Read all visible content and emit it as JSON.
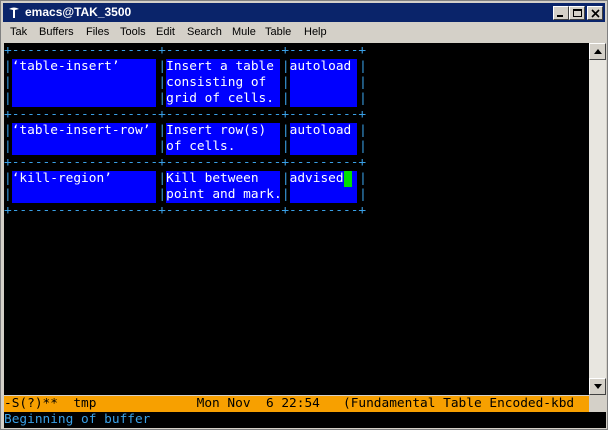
{
  "window": {
    "title": "emacs@TAK_3500"
  },
  "menu": [
    "Tak",
    "Buffers",
    "Files",
    "Tools",
    "Edit",
    "Search",
    "Mule",
    "Table",
    "Help"
  ],
  "buffer": {
    "border": "+-------------------+---------------+---------+",
    "rows": [
      {
        "cells": [
          [
            "‘table-insert’"
          ],
          [
            "Insert a table",
            "consisting of",
            "grid of cells."
          ],
          [
            "autoload"
          ]
        ]
      },
      {
        "cells": [
          [
            "‘table-insert-row’"
          ],
          [
            "Insert row(s)",
            "of cells."
          ],
          [
            "autoload"
          ]
        ]
      },
      {
        "cells": [
          [
            "‘kill-region’"
          ],
          [
            "Kill between",
            "point and mark."
          ],
          [
            "advised"
          ]
        ]
      }
    ]
  },
  "modeline": {
    "text": "-S(?)**  tmp             Mon Nov  6 22:54   (Fundamental Table Encoded-kbd"
  },
  "minibuffer": {
    "text": "Beginning of buffer"
  },
  "colors": {
    "cell_bg": "#0000ff",
    "border": "#3aa0e6",
    "modeline": "#f7a000",
    "cursor": "#00e000"
  }
}
